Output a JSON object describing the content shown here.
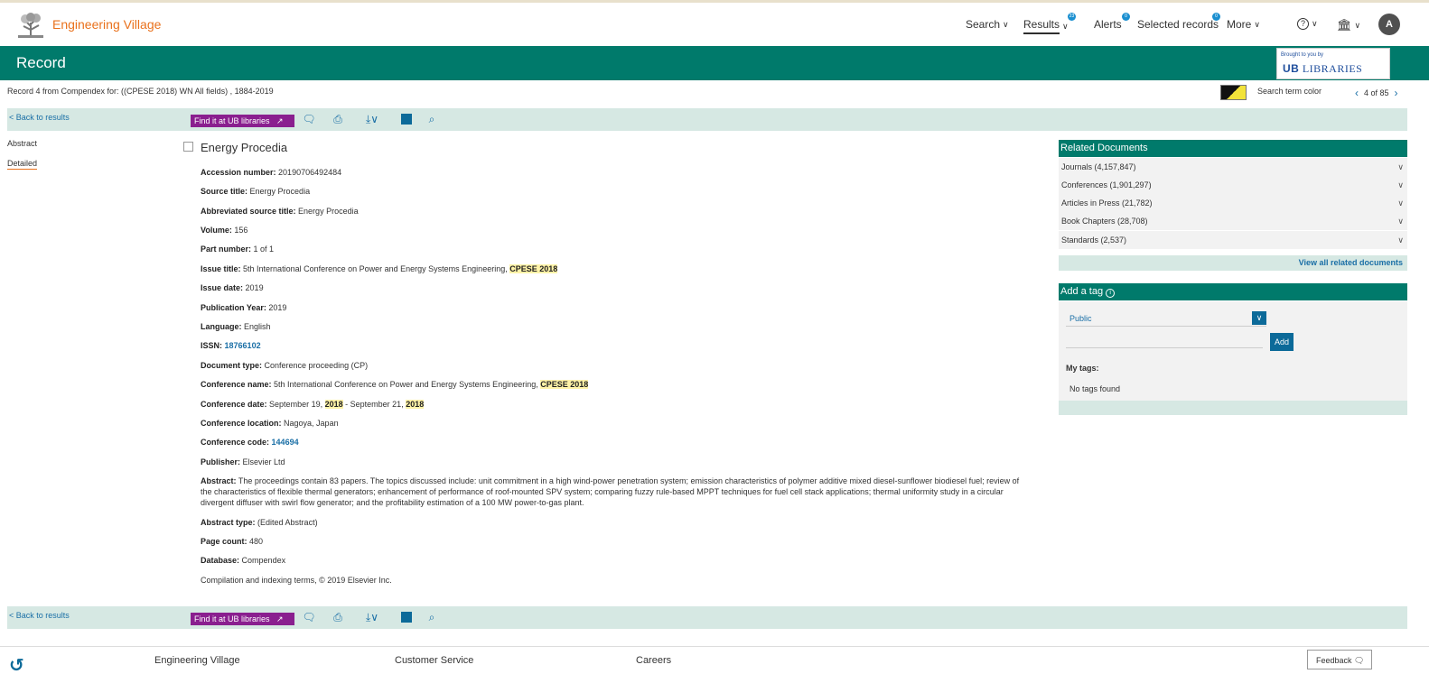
{
  "header": {
    "brand": "Engineering Village",
    "nav": {
      "search": "Search",
      "results": "Results",
      "results_badge": "23",
      "alerts": "Alerts",
      "alerts_badge": "0",
      "selected": "Selected records",
      "selected_badge": "0",
      "more": "More"
    },
    "avatar": "A"
  },
  "bar": {
    "title": "Record",
    "partner_small": "Brought to you by",
    "partner_name": "LIBRARIES"
  },
  "record_info": {
    "text": "Record 4 from Compendex for: ((CPESE 2018) WN All fields) , 1884-2019",
    "search_term_color": "Search term color",
    "pager": "4 of 85"
  },
  "toolbar": {
    "back": "< Back to results",
    "find": "Find it at UB libraries"
  },
  "leftnav": {
    "abstract": "Abstract",
    "detailed": "Detailed"
  },
  "record": {
    "title": "Energy Procedia",
    "accession_label": "Accession number:",
    "accession": "20190706492484",
    "source_label": "Source title:",
    "source": "Energy Procedia",
    "abbr_label": "Abbreviated source title:",
    "abbr": "Energy Procedia",
    "volume_label": "Volume:",
    "volume": "156",
    "part_label": "Part number:",
    "part": "1 of 1",
    "issue_title_label": "Issue title:",
    "issue_title": "5th International Conference on Power and Energy Systems Engineering,",
    "issue_title_hl": "CPESE 2018",
    "issue_date_label": "Issue date:",
    "issue_date": "2019",
    "pubyear_label": "Publication Year:",
    "pubyear": "2019",
    "language_label": "Language:",
    "language": "English",
    "issn_label": "ISSN:",
    "issn": "18766102",
    "doctype_label": "Document type:",
    "doctype": "Conference proceeding (CP)",
    "confname_label": "Conference name:",
    "confname": "5th International Conference on Power and Energy Systems Engineering,",
    "confname_hl": "CPESE 2018",
    "confdate_label": "Conference date:",
    "confdate_a": "September 19,",
    "confdate_hl1": "2018",
    "confdate_b": "- September 21,",
    "confdate_hl2": "2018",
    "conflocation_label": "Conference location:",
    "conflocation": "Nagoya, Japan",
    "confcode_label": "Conference code:",
    "confcode": "144694",
    "publisher_label": "Publisher:",
    "publisher": "Elsevier Ltd",
    "abstract_label": "Abstract:",
    "abstract": "The proceedings contain 83 papers. The topics discussed include: unit commitment in a high wind-power penetration system; emission characteristics of polymer additive mixed diesel-sunflower biodiesel fuel; review of the characteristics of flexible thermal generators; enhancement of performance of roof-mounted SPV system; comparing fuzzy rule-based MPPT techniques for fuel cell stack applications; thermal uniformity study in a circular divergent diffuser with swirl flow generator; and the profitability estimation of a 100 MW power-to-gas plant.",
    "abstract_type_label": "Abstract type:",
    "abstract_type": "(Edited Abstract)",
    "pagecount_label": "Page count:",
    "pagecount": "480",
    "database_label": "Database:",
    "database": "Compendex",
    "copyright": "Compilation and indexing terms, © 2019 Elsevier Inc."
  },
  "related": {
    "title": "Related Documents",
    "items": [
      "Journals (4,157,847)",
      "Conferences (1,901,297)",
      "Articles in Press (21,782)",
      "Book Chapters (28,708)",
      "Standards (2,537)"
    ],
    "view_all": "View all related documents"
  },
  "tag": {
    "title": "Add a tag",
    "visibility": "Public",
    "add": "Add",
    "my_tags": "My tags:",
    "no_tags": "No tags found"
  },
  "footer": {
    "link1": "Engineering Village",
    "link2": "Customer Service",
    "link3": "Careers",
    "feedback": "Feedback"
  },
  "colors": {
    "brand_orange": "#e9711c",
    "teal": "#007a6b",
    "purple": "#8a1f8f",
    "blue": "#0c6a99"
  }
}
